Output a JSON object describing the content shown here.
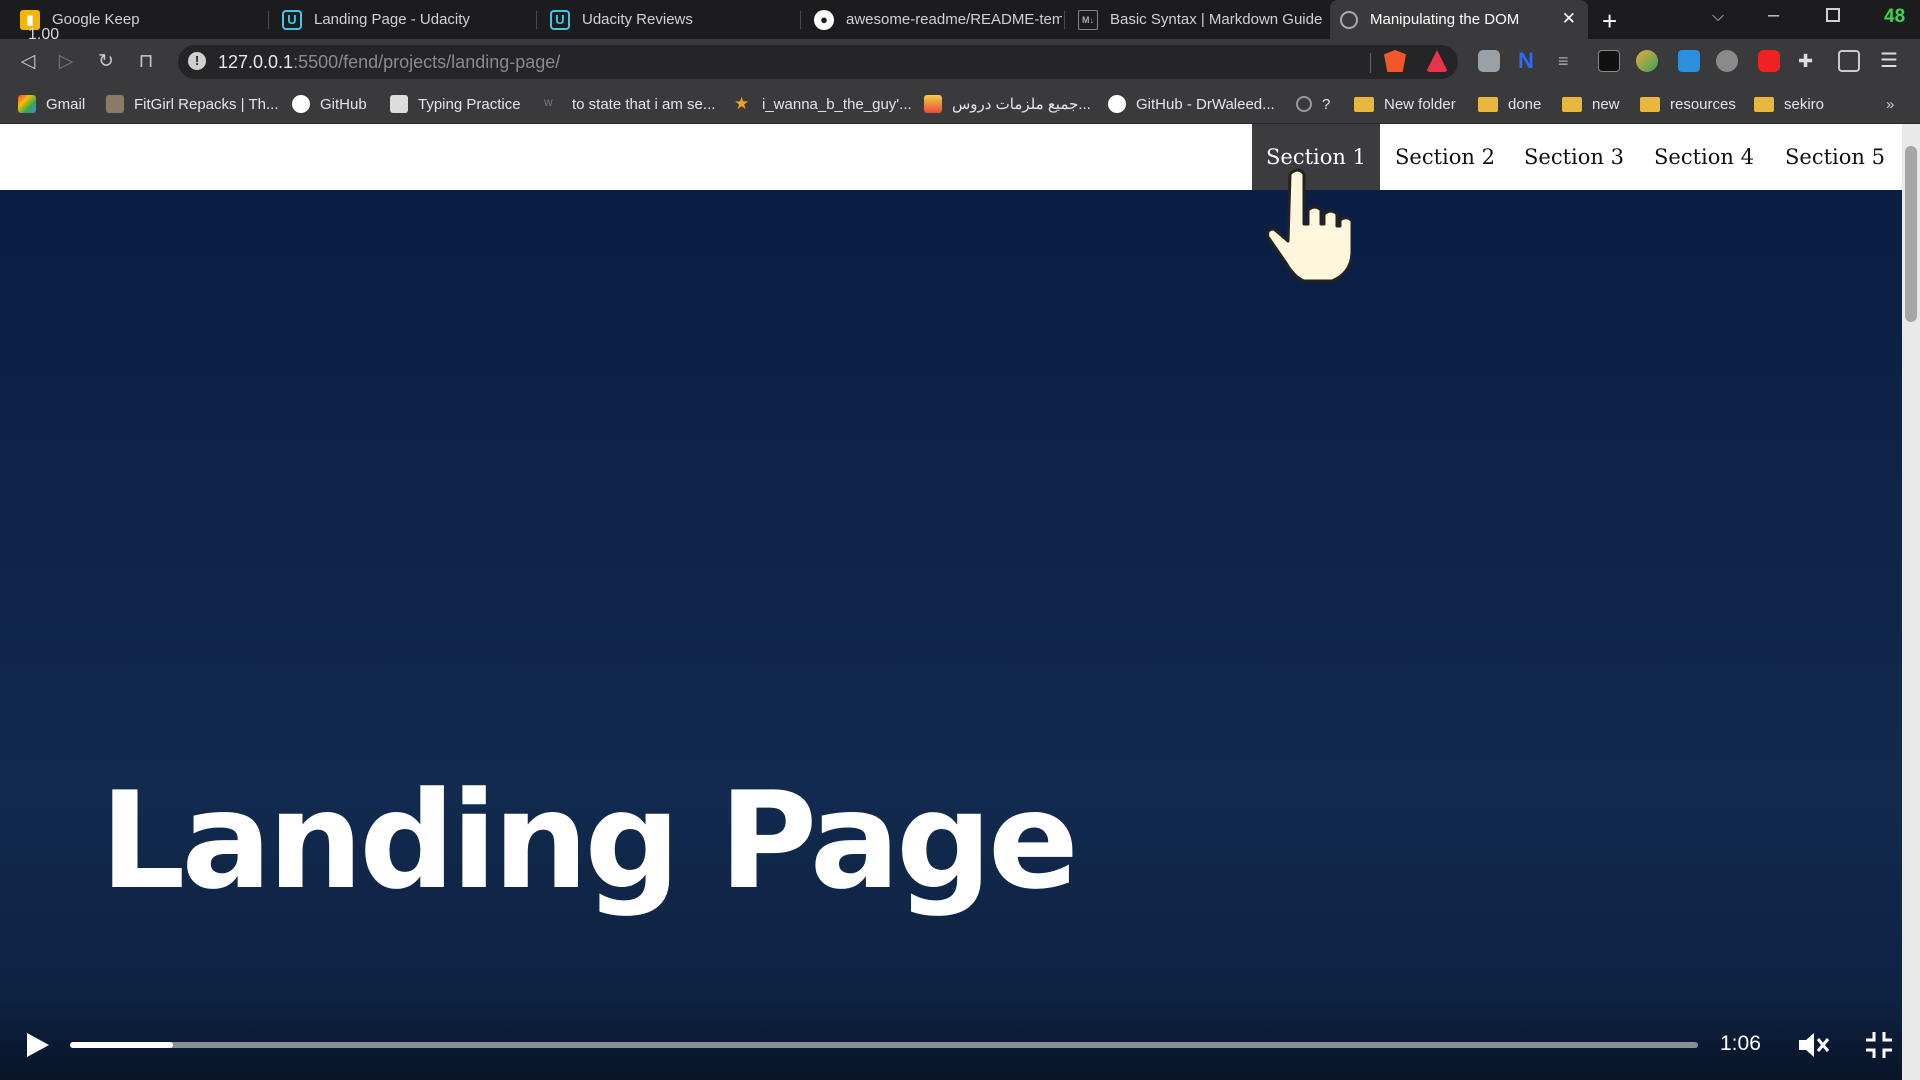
{
  "browser": {
    "speed_badge": "1.00",
    "tabs": [
      {
        "title": "Google Keep",
        "icon": "google-keep-icon"
      },
      {
        "title": "Landing Page - Udacity",
        "icon": "udacity-icon"
      },
      {
        "title": "Udacity Reviews",
        "icon": "udacity-icon"
      },
      {
        "title": "awesome-readme/README-tem",
        "icon": "github-icon"
      },
      {
        "title": "Basic Syntax | Markdown Guide",
        "icon": "markdown-icon"
      },
      {
        "title": "Manipulating the DOM",
        "icon": "globe-icon"
      }
    ],
    "url_host": "127.0.0.1",
    "url_rest": ":5500/fend/projects/landing-page/",
    "window_counter": "48",
    "bookmarks": [
      {
        "label": "Gmail",
        "icon": "gmail-icon"
      },
      {
        "label": "FitGirl Repacks | Th...",
        "icon": "fitgirl-icon"
      },
      {
        "label": "GitHub",
        "icon": "github-icon"
      },
      {
        "label": "Typing Practice",
        "icon": "typing-icon"
      },
      {
        "label": "to state that i am se...",
        "icon": "w-icon"
      },
      {
        "label": "i_wanna_b_the_guy'...",
        "icon": "star-icon"
      },
      {
        "label": "جميع ملزمات دروس...",
        "icon": "book-icon"
      },
      {
        "label": "GitHub - DrWaleed...",
        "icon": "github-icon"
      },
      {
        "label": "?",
        "icon": "globe-icon"
      },
      {
        "label": "New folder",
        "icon": "folder-icon"
      },
      {
        "label": "done",
        "icon": "folder-icon"
      },
      {
        "label": "new",
        "icon": "folder-icon"
      },
      {
        "label": "resources",
        "icon": "folder-icon"
      },
      {
        "label": "sekiro",
        "icon": "folder-icon"
      }
    ],
    "bookmarks_more": "»"
  },
  "page": {
    "nav": [
      {
        "label": "Section 1",
        "active": true
      },
      {
        "label": "Section 2",
        "active": false
      },
      {
        "label": "Section 3",
        "active": false
      },
      {
        "label": "Section 4",
        "active": false
      },
      {
        "label": "Section 5",
        "active": false
      }
    ],
    "hero_title": "Landing Page"
  },
  "video": {
    "timecode": "1:06",
    "progress": 0.063,
    "muted": true
  },
  "colors": {
    "page_bg": "#0b1d3a",
    "nav_active": "#3c3c3f",
    "tab_bar": "#1c1c1e",
    "toolbar": "#3a3a3d"
  }
}
